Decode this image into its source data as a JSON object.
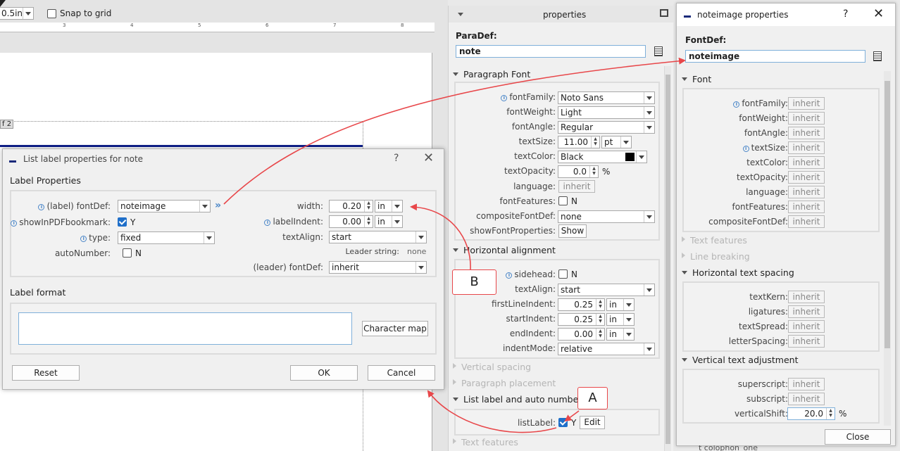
{
  "canvas": {
    "zoom_value": "0.5in",
    "snap_label": "Snap to grid",
    "ruler_marks": [
      "3",
      "4",
      "5",
      "6",
      "7",
      "8"
    ],
    "page_tag": "f 2"
  },
  "properties_panel": {
    "title": "properties",
    "paradef_label": "ParaDef:",
    "paradef_value": "note",
    "paragraph_font": {
      "header": "Paragraph Font",
      "fontFamily": {
        "label": "fontFamily:",
        "value": "Noto Sans"
      },
      "fontWeight": {
        "label": "fontWeight:",
        "value": "Light"
      },
      "fontAngle": {
        "label": "fontAngle:",
        "value": "Regular"
      },
      "textSize": {
        "label": "textSize:",
        "value": "11.00",
        "unit": "pt"
      },
      "textColor": {
        "label": "textColor:",
        "value": "Black"
      },
      "textOpacity": {
        "label": "textOpacity:",
        "value": "0.0",
        "unit": "%"
      },
      "language": {
        "label": "language:",
        "value": "inherit"
      },
      "fontFeatures": {
        "label": "fontFeatures:",
        "value": "N"
      },
      "compositeFontDef": {
        "label": "compositeFontDef:",
        "value": "none"
      },
      "showFontProperties": {
        "label": "showFontProperties:",
        "button": "Show"
      }
    },
    "horizontal_alignment": {
      "header": "Horizontal alignment",
      "sidehead": {
        "label": "sidehead:",
        "value": "N"
      },
      "textAlign": {
        "label": "textAlign:",
        "value": "start"
      },
      "firstLineIndent": {
        "label": "firstLineIndent:",
        "value": "0.25",
        "unit": "in"
      },
      "startIndent": {
        "label": "startIndent:",
        "value": "0.25",
        "unit": "in"
      },
      "endIndent": {
        "label": "endIndent:",
        "value": "0.00",
        "unit": "in"
      },
      "indentMode": {
        "label": "indentMode:",
        "value": "relative"
      }
    },
    "collapsed": [
      "Vertical spacing",
      "Paragraph placement"
    ],
    "list_label": {
      "header": "List label and auto numbering",
      "label": "listLabel:",
      "value": "Y",
      "edit_button": "Edit"
    },
    "text_features": "Text features"
  },
  "noteimage_panel": {
    "title": "noteimage properties",
    "fontdef_label": "FontDef:",
    "fontdef_value": "noteimage",
    "font": {
      "header": "Font",
      "rows": [
        {
          "label": "fontFamily:",
          "value": "inherit"
        },
        {
          "label": "fontWeight:",
          "value": "inherit"
        },
        {
          "label": "fontAngle:",
          "value": "inherit"
        },
        {
          "label": "textSize:",
          "value": "inherit"
        },
        {
          "label": "textColor:",
          "value": "inherit"
        },
        {
          "label": "textOpacity:",
          "value": "inherit"
        },
        {
          "label": "language:",
          "value": "inherit"
        },
        {
          "label": "fontFeatures:",
          "value": "inherit"
        },
        {
          "label": "compositeFontDef:",
          "value": "inherit"
        }
      ]
    },
    "collapsed": [
      "Text features",
      "Line breaking"
    ],
    "h_spacing": {
      "header": "Horizontal text spacing",
      "rows": [
        {
          "label": "textKern:",
          "value": "inherit"
        },
        {
          "label": "ligatures:",
          "value": "inherit"
        },
        {
          "label": "textSpread:",
          "value": "inherit"
        },
        {
          "label": "letterSpacing:",
          "value": "inherit"
        }
      ]
    },
    "v_adjust": {
      "header": "Vertical text adjustment",
      "superscript": {
        "label": "superscript:",
        "value": "inherit"
      },
      "subscript": {
        "label": "subscript:",
        "value": "inherit"
      },
      "verticalShift": {
        "label": "verticalShift:",
        "value": "20.0",
        "unit": "%"
      }
    },
    "close_button": "Close",
    "bottom_text": "t colophon_one"
  },
  "list_dialog": {
    "title": "List label properties for note",
    "label_props_header": "Label Properties",
    "fontDef": {
      "label": "(label) fontDef:",
      "value": "noteimage"
    },
    "showInPDFbookmark": {
      "label": "showInPDFbookmark:",
      "value": "Y"
    },
    "type": {
      "label": "type:",
      "value": "fixed"
    },
    "autoNumber": {
      "label": "autoNumber:",
      "value": "N"
    },
    "width": {
      "label": "width:",
      "value": "0.20",
      "unit": "in"
    },
    "labelIndent": {
      "label": "labelIndent:",
      "value": "0.00",
      "unit": "in"
    },
    "textAlign": {
      "label": "textAlign:",
      "value": "start"
    },
    "leader_string": {
      "label": "Leader string:",
      "value": "none"
    },
    "leader_fontDef": {
      "label": "(leader) fontDef:",
      "value": "inherit"
    },
    "label_format_header": "Label format",
    "char_map_button": "Character map",
    "reset_button": "Reset",
    "ok_button": "OK",
    "cancel_button": "Cancel"
  },
  "callouts": {
    "a": "A",
    "b": "B"
  },
  "colors": {
    "arrow": "#e8474a",
    "accent": "#1f6fc9",
    "dialog_bg": "#f0f0f0"
  }
}
